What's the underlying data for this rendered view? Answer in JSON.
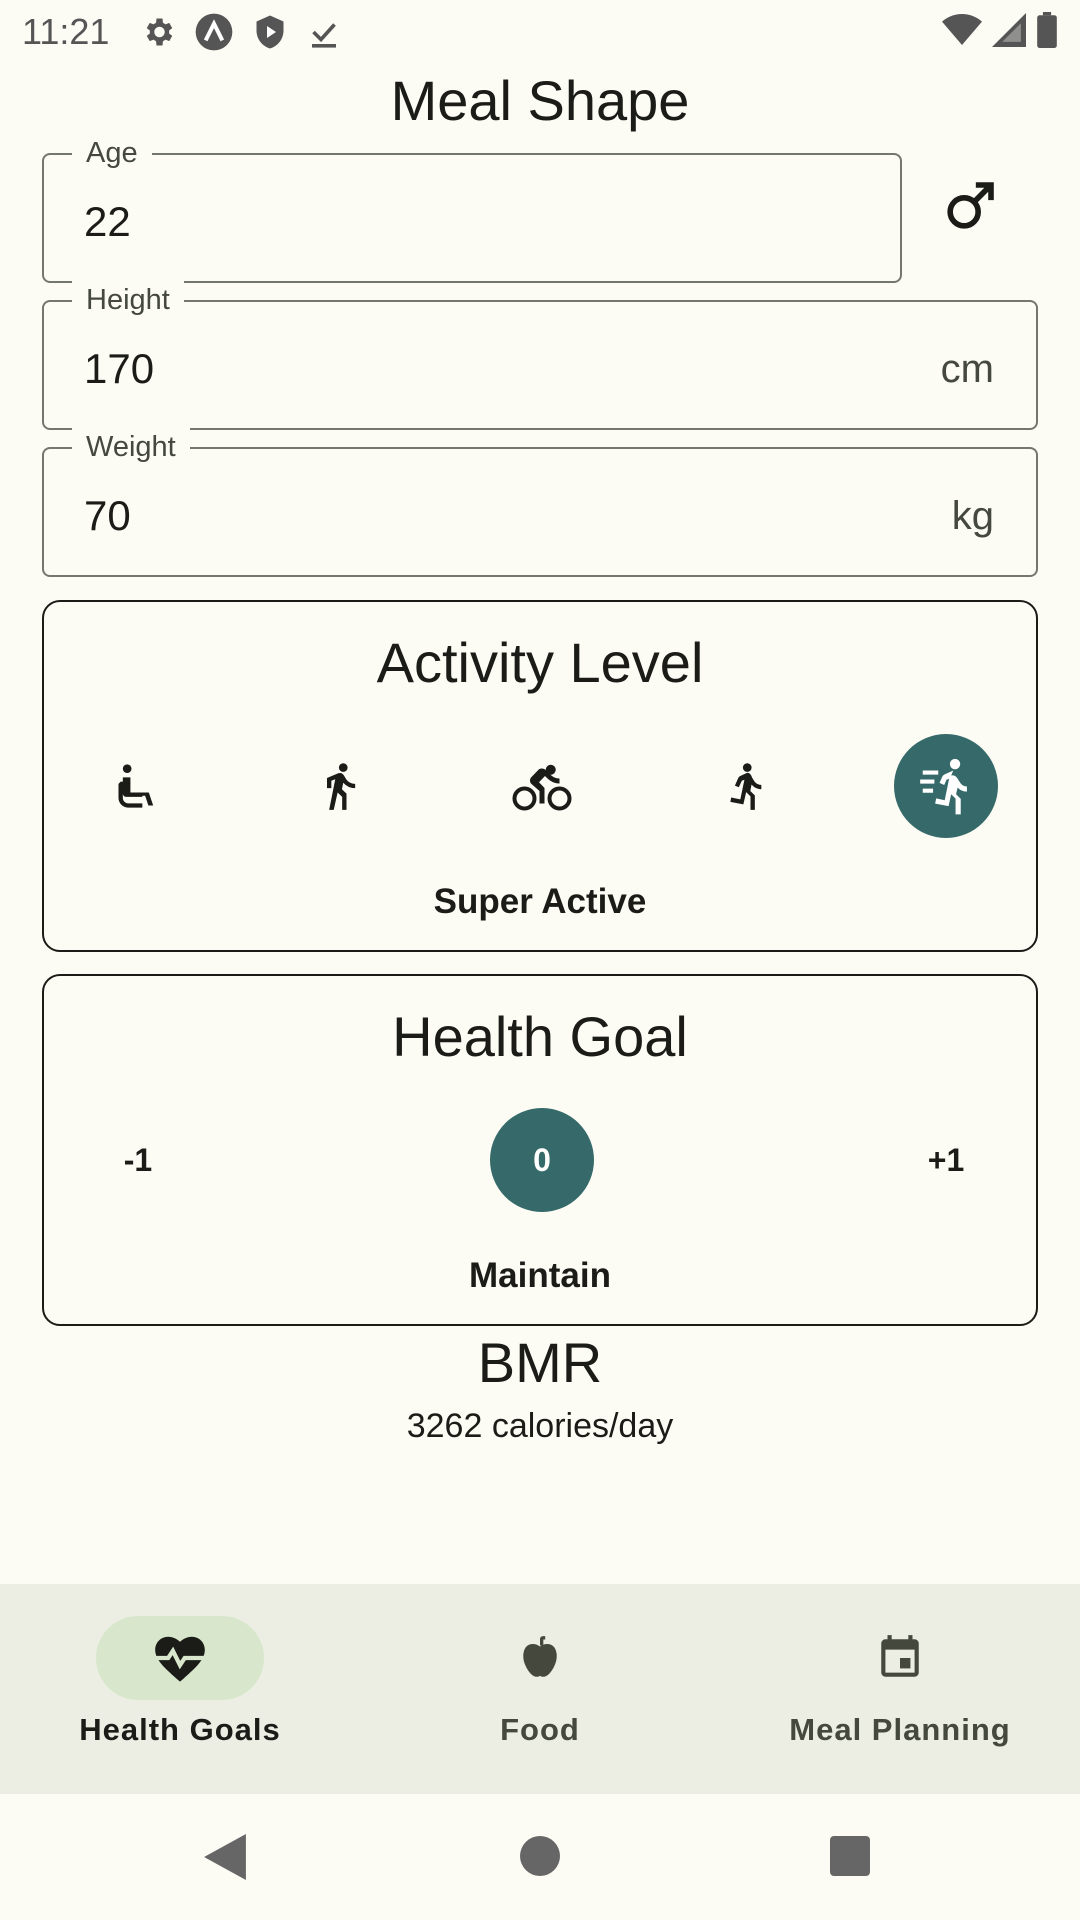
{
  "status_bar": {
    "time": "11:21"
  },
  "app": {
    "title": "Meal Shape"
  },
  "form": {
    "age": {
      "label": "Age",
      "value": "22"
    },
    "height": {
      "label": "Height",
      "value": "170",
      "suffix": "cm"
    },
    "weight": {
      "label": "Weight",
      "value": "70",
      "suffix": "kg"
    },
    "gender_icon": "male-icon"
  },
  "activity": {
    "title": "Activity Level",
    "options": [
      {
        "icon": "sitting-icon",
        "selected": false
      },
      {
        "icon": "walking-icon",
        "selected": false
      },
      {
        "icon": "cycling-icon",
        "selected": false
      },
      {
        "icon": "running-icon",
        "selected": false
      },
      {
        "icon": "sprinting-icon",
        "selected": true
      }
    ],
    "selected_label": "Super Active"
  },
  "goal": {
    "title": "Health Goal",
    "options": [
      "-1",
      "0",
      "+1"
    ],
    "selected_index": 1,
    "selected_label": "Maintain"
  },
  "bmr": {
    "title": "BMR",
    "value": "3262 calories/day"
  },
  "bottom_nav": {
    "items": [
      {
        "label": "Health Goals",
        "icon": "heart-monitor-icon",
        "active": true
      },
      {
        "label": "Food",
        "icon": "apple-icon",
        "active": false
      },
      {
        "label": "Meal Planning",
        "icon": "calendar-icon",
        "active": false
      }
    ]
  },
  "colors": {
    "accent": "#366a6a",
    "nav_active_pill": "#d8e7cc",
    "nav_background": "#eceee3",
    "background": "#fcfcf5"
  }
}
